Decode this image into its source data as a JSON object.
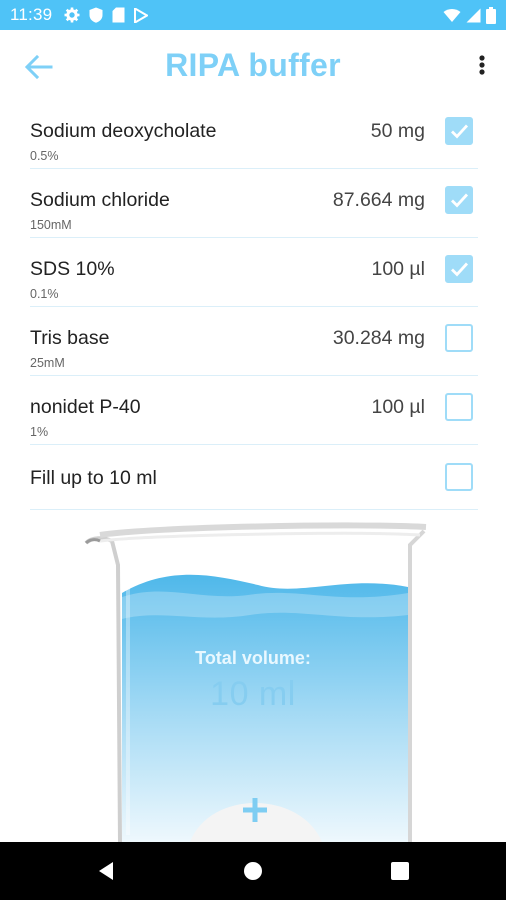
{
  "status_bar": {
    "time": "11:39",
    "left_icons": [
      "gear-icon",
      "shield-icon",
      "sd-card-icon",
      "play-store-icon"
    ],
    "right_icons": [
      "wifi-icon",
      "cell-signal-icon",
      "battery-icon"
    ],
    "background": "#4fc3f7"
  },
  "header": {
    "title": "RIPA buffer",
    "back_icon": "arrow-back-icon",
    "menu_icon": "more-vert-icon",
    "accent": "#7ed0f7"
  },
  "ingredients": [
    {
      "name": "Sodium deoxycholate",
      "sub": "0.5%",
      "amount": "50 mg",
      "checked": true
    },
    {
      "name": "Sodium chloride",
      "sub": "150mM",
      "amount": "87.664 mg",
      "checked": true
    },
    {
      "name": "SDS 10%",
      "sub": "0.1%",
      "amount": "100 µl",
      "checked": true
    },
    {
      "name": "Tris base",
      "sub": "25mM",
      "amount": "30.284 mg",
      "checked": false
    },
    {
      "name": "nonidet P-40",
      "sub": "1%",
      "amount": "100 µl",
      "checked": false
    },
    {
      "name": "Fill up to 10 ml",
      "sub": "",
      "amount": "",
      "checked": false
    }
  ],
  "beaker": {
    "total_label": "Total volume:",
    "total_value": "10 ml",
    "add_icon": "plus-icon"
  },
  "nav_bar": {
    "icons": [
      "back-triangle-icon",
      "home-circle-icon",
      "recents-square-icon"
    ]
  }
}
